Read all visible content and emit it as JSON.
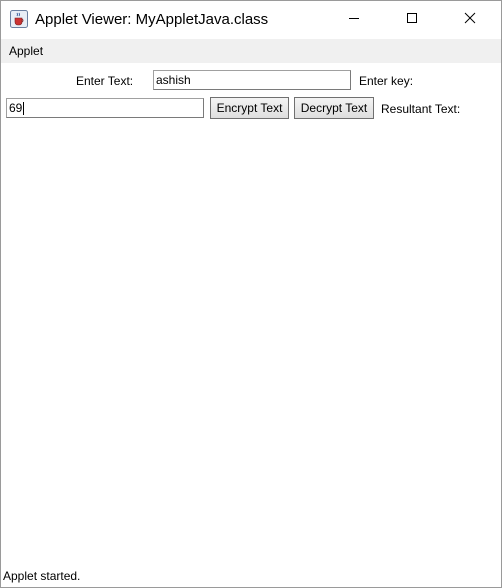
{
  "window": {
    "title": "Applet Viewer: MyAppletJava.class",
    "icon": "java-coffee-cup-icon",
    "controls": [
      "minimize-icon",
      "maximize-icon",
      "close-icon"
    ]
  },
  "menubar": {
    "items": [
      {
        "label": "Applet"
      }
    ]
  },
  "applet": {
    "enter_text_label": "Enter Text:",
    "enter_text_value": "ashish",
    "enter_key_label": "Enter key:",
    "key_value": "69",
    "encrypt_button": "Encrypt Text",
    "decrypt_button": "Decrypt Text",
    "resultant_label": "Resultant Text:"
  },
  "status": {
    "text": "Applet started."
  }
}
